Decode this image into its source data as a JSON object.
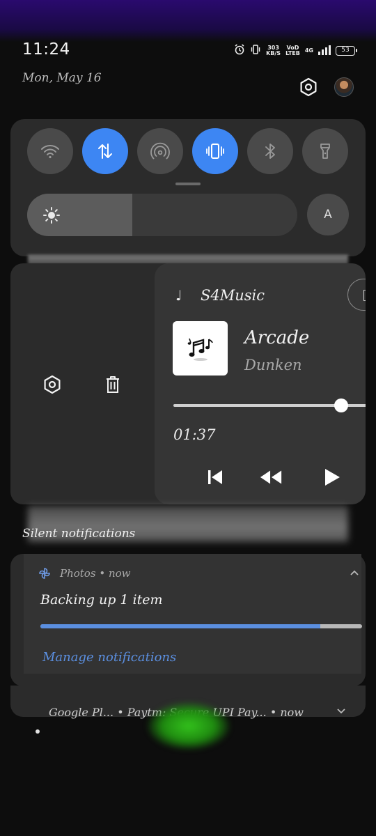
{
  "status_bar": {
    "time": "11:24",
    "net_speed_value": "303",
    "net_speed_unit": "KB/S",
    "volte_top": "VoD",
    "volte_bottom": "LTEB",
    "network_type": "4G",
    "battery_level": "53"
  },
  "header": {
    "date": "Mon, May 16"
  },
  "quick_settings": {
    "toggles": [
      {
        "name": "wifi",
        "active": false
      },
      {
        "name": "mobile-data",
        "active": true
      },
      {
        "name": "hotspot",
        "active": false
      },
      {
        "name": "vibrate",
        "active": true
      },
      {
        "name": "bluetooth",
        "active": false
      },
      {
        "name": "flashlight",
        "active": false
      }
    ],
    "brightness_level": 0.39,
    "auto_brightness_label": "A",
    "accent_color": "#3d86f3"
  },
  "media": {
    "app_name": "S4Music",
    "track_title": "Arcade",
    "artist": "Dunken",
    "elapsed": "01:37",
    "seek_progress": 0.83
  },
  "silent_notifications_label": "Silent notifications",
  "notification": {
    "app": "Photos",
    "separator": "•",
    "time": "now",
    "title": "Backing up 1 item",
    "progress": 0.87,
    "manage_link": "Manage notifications",
    "link_color": "#5b8fe0"
  },
  "collapsed_notification": {
    "text": "Google Pl...  • Paytm: Secure UPI Pay...  • now"
  }
}
